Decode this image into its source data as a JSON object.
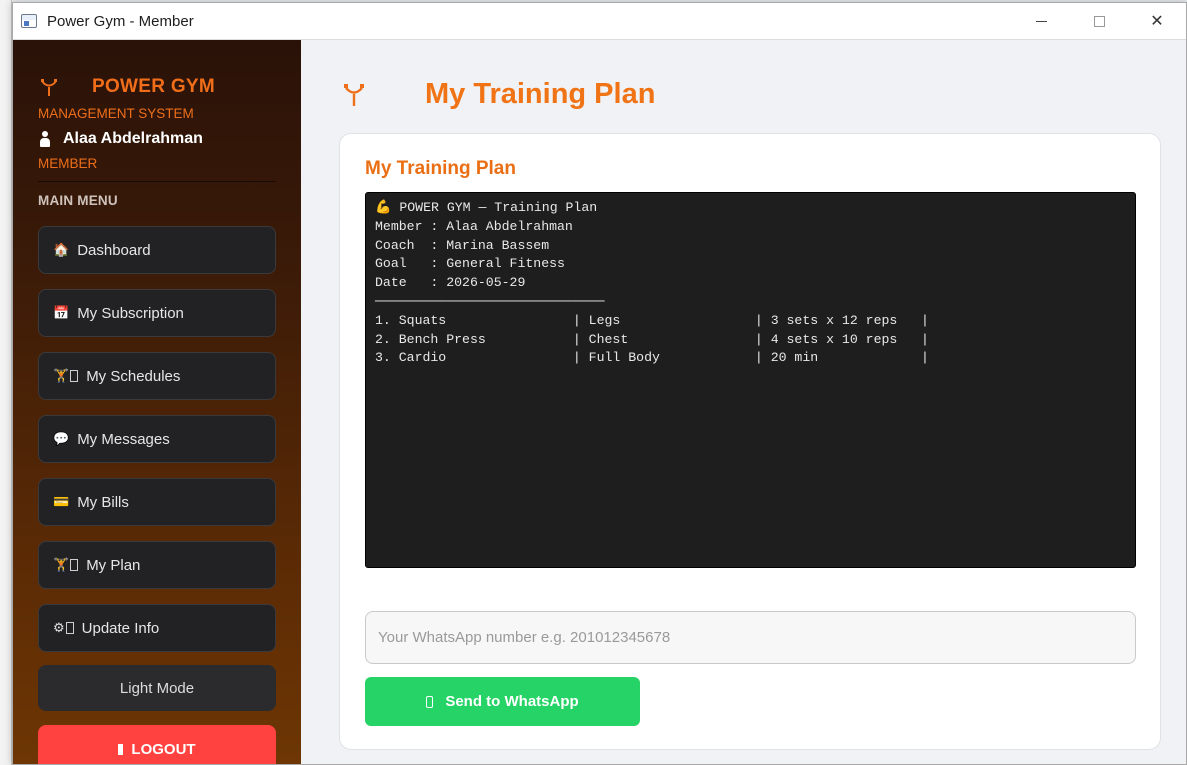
{
  "window": {
    "title": "Power Gym - Member",
    "minimize_icon": "minimize-icon",
    "maximize_icon": "maximize-icon",
    "close_icon": "close-icon",
    "close_glyph": "✕"
  },
  "sidebar": {
    "brand_name": "POWER GYM",
    "brand_subtitle": "MANAGEMENT SYSTEM",
    "user_name": "Alaa Abdelrahman",
    "role": "MEMBER",
    "menu_heading": "MAIN MENU",
    "items": [
      {
        "label": "Dashboard",
        "icon": "home-icon",
        "glyph": "🏠"
      },
      {
        "label": "My Subscription",
        "icon": "calendar-icon",
        "glyph": "📅"
      },
      {
        "label": "My Schedules",
        "icon": "dumbbell-icon",
        "glyph": "🏋"
      },
      {
        "label": "My Messages",
        "icon": "chat-icon",
        "glyph": "💬"
      },
      {
        "label": "My Bills",
        "icon": "credit-card-icon",
        "glyph": "💳"
      },
      {
        "label": "My Plan",
        "icon": "dumbbell-icon",
        "glyph": "🏋"
      },
      {
        "label": "Update Info",
        "icon": "gear-icon",
        "glyph": "⚙"
      }
    ],
    "light_mode_label": "Light Mode",
    "logout_label": "LOGOUT"
  },
  "main": {
    "page_title": "My Training Plan",
    "card_title": "My Training Plan",
    "plan_lines": [
      "💪 POWER GYM — Training Plan",
      "Member : Alaa Abdelrahman",
      "Coach  : Marina Bassem",
      "Goal   : General Fitness",
      "Date   : 2026-05-29",
      "─────────────────────────────",
      "1. Squats                | Legs                 | 3 sets x 12 reps   |",
      "2. Bench Press           | Chest                | 4 sets x 10 reps   |",
      "3. Cardio                | Full Body            | 20 min             |"
    ],
    "whatsapp_placeholder": "Your WhatsApp number e.g. 201012345678",
    "whatsapp_value": "",
    "send_label": "Send to WhatsApp"
  },
  "colors": {
    "accent_orange": "#f07316",
    "logout_red": "#ff4140",
    "whatsapp_green": "#25d366",
    "terminal_bg": "#1e1e1e"
  }
}
